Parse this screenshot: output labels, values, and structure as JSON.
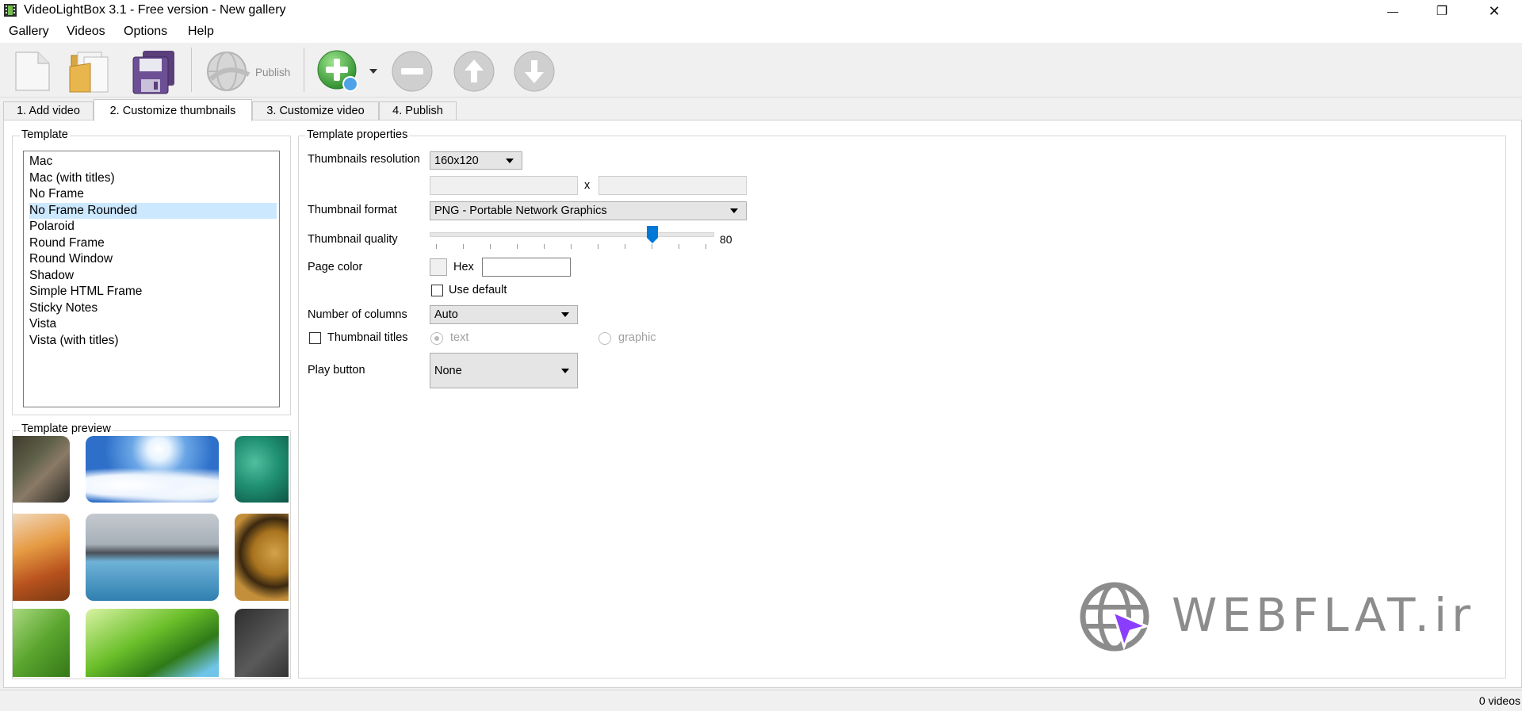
{
  "window": {
    "title": "VideoLightBox 3.1 - Free version - New gallery",
    "minimize_glyph": "—",
    "maximize_glyph": "❐",
    "close_glyph": "✕"
  },
  "menu": [
    "Gallery",
    "Videos",
    "Options",
    "Help"
  ],
  "toolbar": {
    "publish_label": "Publish",
    "icons": [
      "new-gallery-icon",
      "open-folder-icon",
      "save-icon",
      "publish-globe-icon",
      "add-video-icon",
      "remove-video-icon",
      "move-up-icon",
      "move-down-icon"
    ]
  },
  "tabs": [
    "1. Add video",
    "2. Customize thumbnails",
    "3. Customize video",
    "4. Publish"
  ],
  "active_tab": 1,
  "template": {
    "group_label": "Template",
    "items": [
      "Mac",
      "Mac (with titles)",
      "No Frame",
      "No Frame Rounded",
      "Polaroid",
      "Round Frame",
      "Round Window",
      "Shadow",
      "Simple HTML Frame",
      "Sticky Notes",
      "Vista",
      "Vista (with titles)"
    ],
    "selected_index": 3,
    "preview_label": "Template preview"
  },
  "properties": {
    "group_label": "Template properties",
    "thumbnails_resolution_label": "Thumbnails resolution",
    "thumbnails_resolution_value": "160x120",
    "times_sign": "x",
    "thumbnail_format_label": "Thumbnail format",
    "thumbnail_format_value": "PNG - Portable Network Graphics",
    "thumbnail_quality_label": "Thumbnail quality",
    "thumbnail_quality_value": "80",
    "page_color_label": "Page color",
    "hex_label": "Hex",
    "hex_value": "",
    "use_default_label": "Use default",
    "number_of_columns_label": "Number of columns",
    "number_of_columns_value": "Auto",
    "thumbnail_titles_label": "Thumbnail titles",
    "radio_text_label": "text",
    "radio_graphic_label": "graphic",
    "play_button_label": "Play button",
    "play_button_value": "None"
  },
  "watermark": {
    "text": "WEBFLAT.ir",
    "accent": "#8b3dff"
  },
  "status": {
    "videos_count": "0 videos"
  },
  "colors": {
    "selection": "#cce8ff",
    "slider_thumb": "#0078d7",
    "add_green": "#3aa63a"
  }
}
